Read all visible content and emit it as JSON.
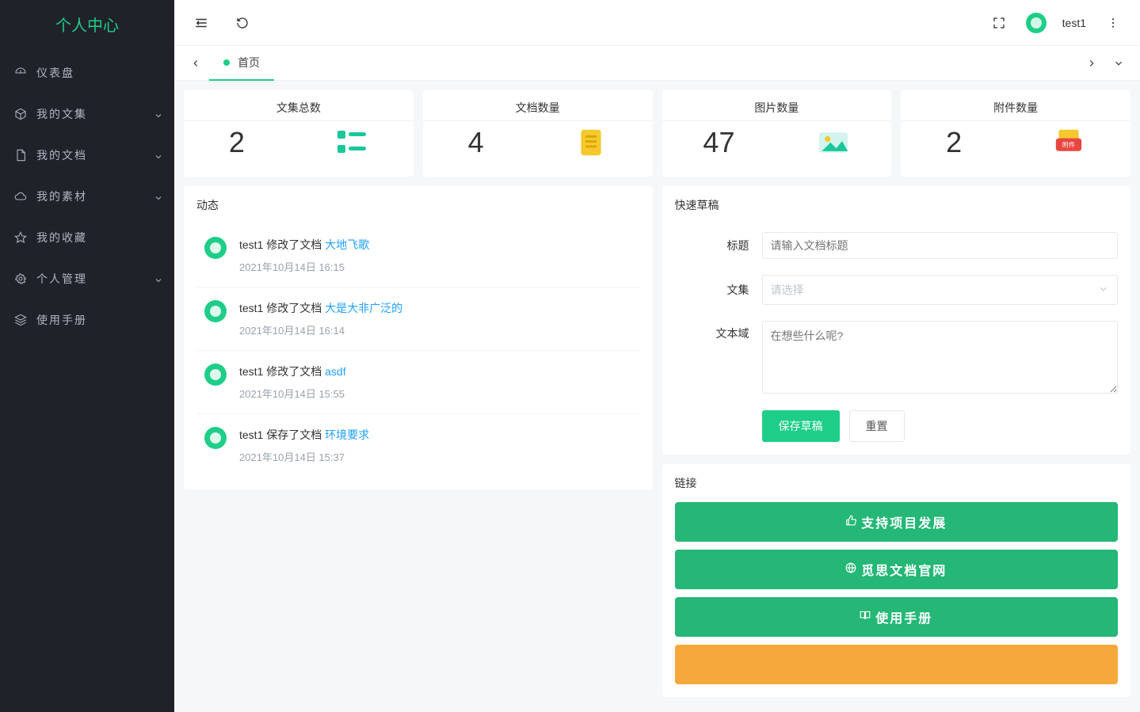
{
  "brand": "个人中心",
  "sidebar": [
    {
      "icon": "dashboard",
      "label": "仪表盘",
      "expand": false
    },
    {
      "icon": "cube",
      "label": "我的文集",
      "expand": true
    },
    {
      "icon": "file",
      "label": "我的文档",
      "expand": true
    },
    {
      "icon": "cloud",
      "label": "我的素材",
      "expand": true
    },
    {
      "icon": "star",
      "label": "我的收藏",
      "expand": false
    },
    {
      "icon": "gear",
      "label": "个人管理",
      "expand": true
    },
    {
      "icon": "layers",
      "label": "使用手册",
      "expand": false
    }
  ],
  "topbar": {
    "username": "test1"
  },
  "tabs": {
    "active_label": "首页"
  },
  "stats": [
    {
      "title": "文集总数",
      "value": "2",
      "icon": "list-teal"
    },
    {
      "title": "文档数量",
      "value": "4",
      "icon": "doc-yellow"
    },
    {
      "title": "图片数量",
      "value": "47",
      "icon": "image-teal"
    },
    {
      "title": "附件数量",
      "value": "2",
      "icon": "attach-red"
    }
  ],
  "activity": {
    "title": "动态",
    "items": [
      {
        "user": "test1",
        "action": "修改了文档",
        "link": "大地飞歌",
        "time": "2021年10月14日 16:15"
      },
      {
        "user": "test1",
        "action": "修改了文档",
        "link": "大是大非广泛的",
        "time": "2021年10月14日 16:14"
      },
      {
        "user": "test1",
        "action": "修改了文档",
        "link": "asdf",
        "time": "2021年10月14日 15:55"
      },
      {
        "user": "test1",
        "action": "保存了文档",
        "link": "环境要求",
        "time": "2021年10月14日 15:37"
      }
    ]
  },
  "draft": {
    "title": "快速草稿",
    "label_title": "标题",
    "placeholder_title": "请输入文档标题",
    "label_collection": "文集",
    "placeholder_collection": "请选择",
    "label_body": "文本域",
    "placeholder_body": "在想些什么呢?",
    "btn_save": "保存草稿",
    "btn_reset": "重置"
  },
  "links": {
    "title": "链接",
    "items": [
      {
        "icon": "thumb",
        "label": "支持项目发展",
        "color": "green"
      },
      {
        "icon": "globe",
        "label": "觅思文档官网",
        "color": "green"
      },
      {
        "icon": "book",
        "label": "使用手册",
        "color": "green"
      },
      {
        "icon": "",
        "label": "",
        "color": "orange"
      }
    ]
  }
}
